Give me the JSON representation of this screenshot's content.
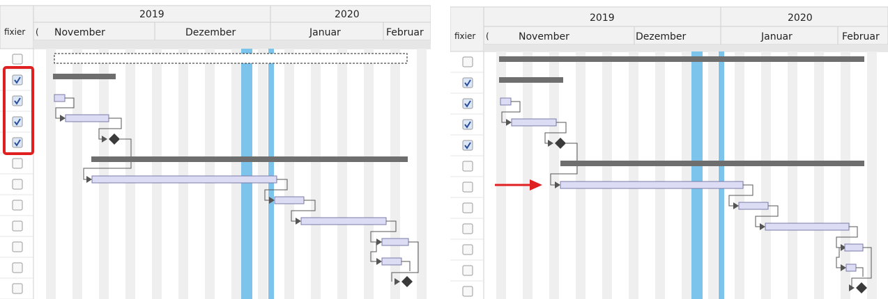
{
  "gantt_left": {
    "column_header": "fixier",
    "column_header_sub": "(",
    "years": [
      "2019",
      "2020"
    ],
    "months": [
      "November",
      "Dezember",
      "Januar",
      "Februar"
    ],
    "rows": [
      {
        "checked": false,
        "kind": "project-selected"
      },
      {
        "checked": true,
        "kind": "summary"
      },
      {
        "checked": true,
        "kind": "task"
      },
      {
        "checked": true,
        "kind": "task"
      },
      {
        "checked": true,
        "kind": "milestone"
      },
      {
        "checked": false,
        "kind": "summary"
      },
      {
        "checked": false,
        "kind": "task"
      },
      {
        "checked": false,
        "kind": "task"
      },
      {
        "checked": false,
        "kind": "task"
      },
      {
        "checked": false,
        "kind": "task"
      },
      {
        "checked": false,
        "kind": "task"
      },
      {
        "checked": false,
        "kind": "milestone"
      }
    ],
    "highlight_color": "#e02020"
  },
  "gantt_right": {
    "column_header": "fixier",
    "column_header_sub": "(",
    "years": [
      "2019",
      "2020"
    ],
    "months": [
      "November",
      "Dezember",
      "Januar",
      "Februar"
    ],
    "rows": [
      {
        "checked": false,
        "kind": "project"
      },
      {
        "checked": true,
        "kind": "summary"
      },
      {
        "checked": true,
        "kind": "task"
      },
      {
        "checked": true,
        "kind": "task"
      },
      {
        "checked": true,
        "kind": "milestone"
      },
      {
        "checked": false,
        "kind": "summary"
      },
      {
        "checked": false,
        "kind": "task"
      },
      {
        "checked": false,
        "kind": "task"
      },
      {
        "checked": false,
        "kind": "task"
      },
      {
        "checked": false,
        "kind": "task"
      },
      {
        "checked": false,
        "kind": "task"
      },
      {
        "checked": false,
        "kind": "milestone"
      }
    ],
    "arrow_color": "#e02020"
  },
  "colors": {
    "today_line": "#7cc4ec",
    "summary_bar": "#6e6e6e",
    "task_fill": "#dcdcf4",
    "task_border": "#7a7aa8",
    "milestone": "#3a3a3a",
    "weekend": "#efefef",
    "header_bg": "#f2f2f2"
  }
}
